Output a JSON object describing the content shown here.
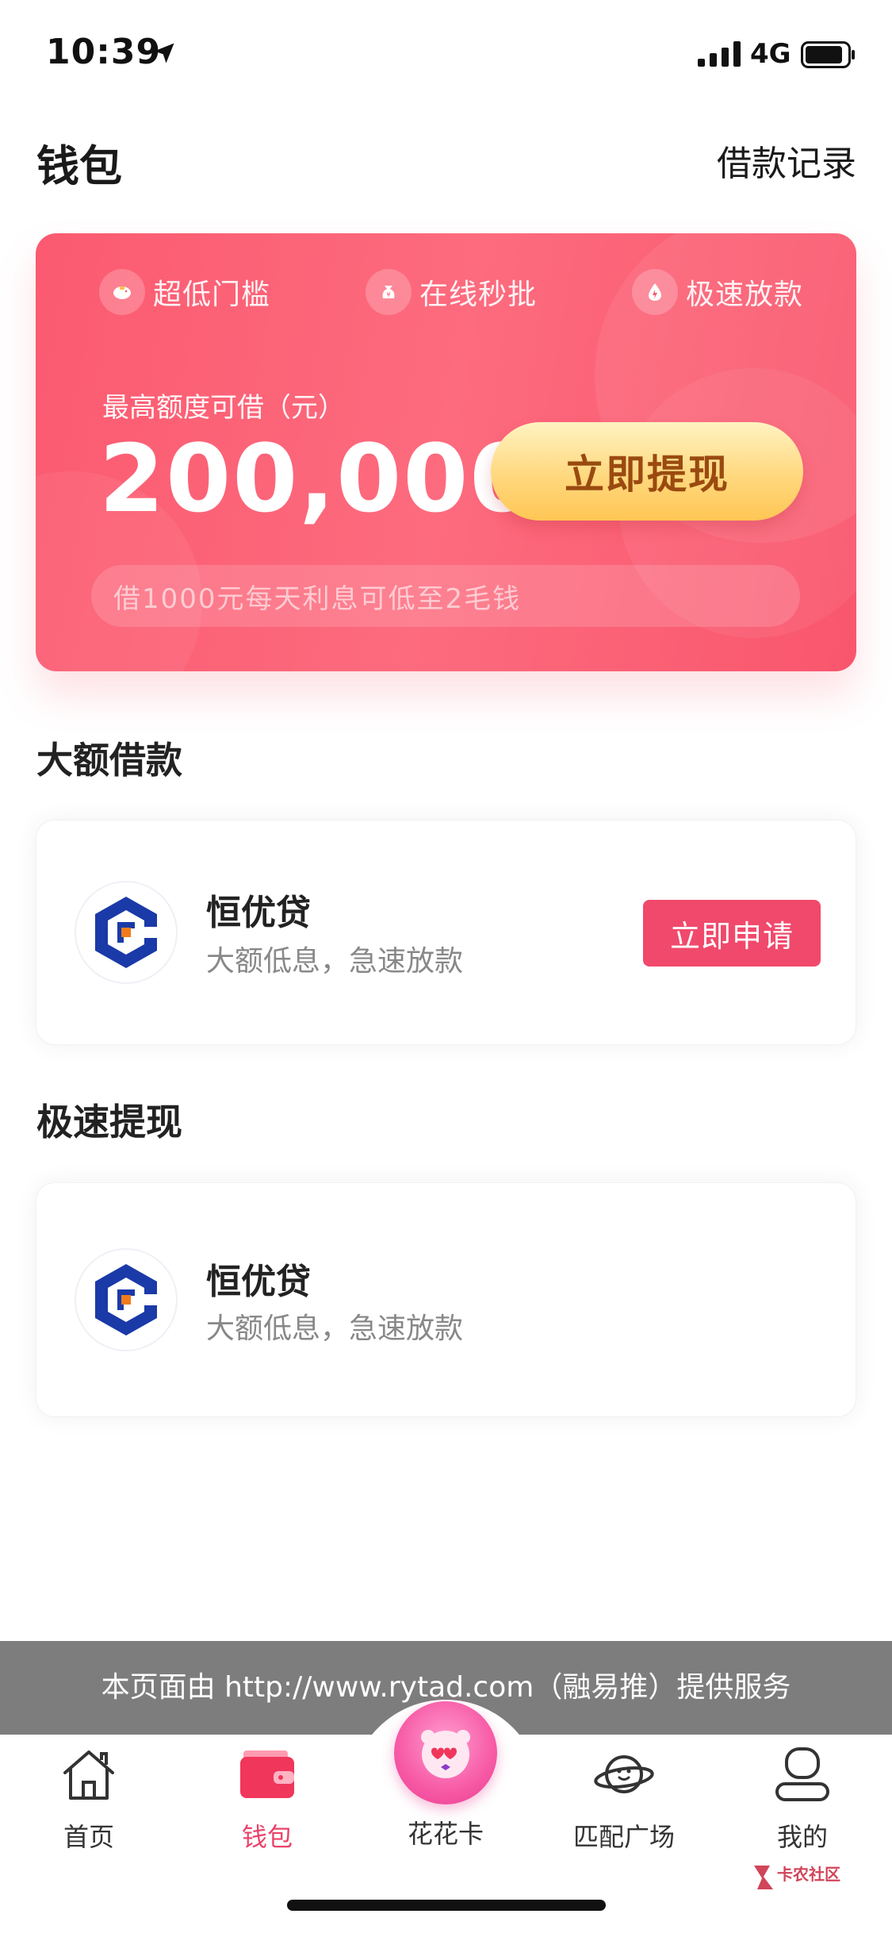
{
  "status_bar": {
    "time": "10:39",
    "network": "4G"
  },
  "header": {
    "title": "钱包",
    "record_link": "借款记录"
  },
  "hero": {
    "features": [
      {
        "label": "超低门槛",
        "icon": "piggy-bank-icon"
      },
      {
        "label": "在线秒批",
        "icon": "money-bag-icon"
      },
      {
        "label": "极速放款",
        "icon": "drop-icon"
      }
    ],
    "max_label": "最高额度可借（元）",
    "amount": "200,000",
    "withdraw_button": "立即提现",
    "promo": "借1000元每天利息可低至2毛钱"
  },
  "sections": [
    {
      "title": "大额借款",
      "product": {
        "name": "恒优贷",
        "desc": "大额低息，急速放款",
        "button": "立即申请"
      }
    },
    {
      "title": "极速提现",
      "product": {
        "name": "恒优贷",
        "desc": "大额低息，急速放款"
      }
    }
  ],
  "service_banner": "本页面由 http://www.rytad.com（融易推）提供服务",
  "tabs": [
    {
      "label": "首页",
      "icon": "home-icon",
      "active": false
    },
    {
      "label": "钱包",
      "icon": "wallet-icon",
      "active": true
    },
    {
      "label": "花花卡",
      "icon": "flower-card-icon",
      "active": false
    },
    {
      "label": "匹配广场",
      "icon": "planet-icon",
      "active": false
    },
    {
      "label": "我的",
      "icon": "profile-icon",
      "active": false
    }
  ],
  "watermark": "卡农社区",
  "colors": {
    "accent": "#f0496c",
    "card_gradient_start": "#fb5a70",
    "button_gold": "#ffd87e",
    "tab_active": "#e9436a"
  }
}
